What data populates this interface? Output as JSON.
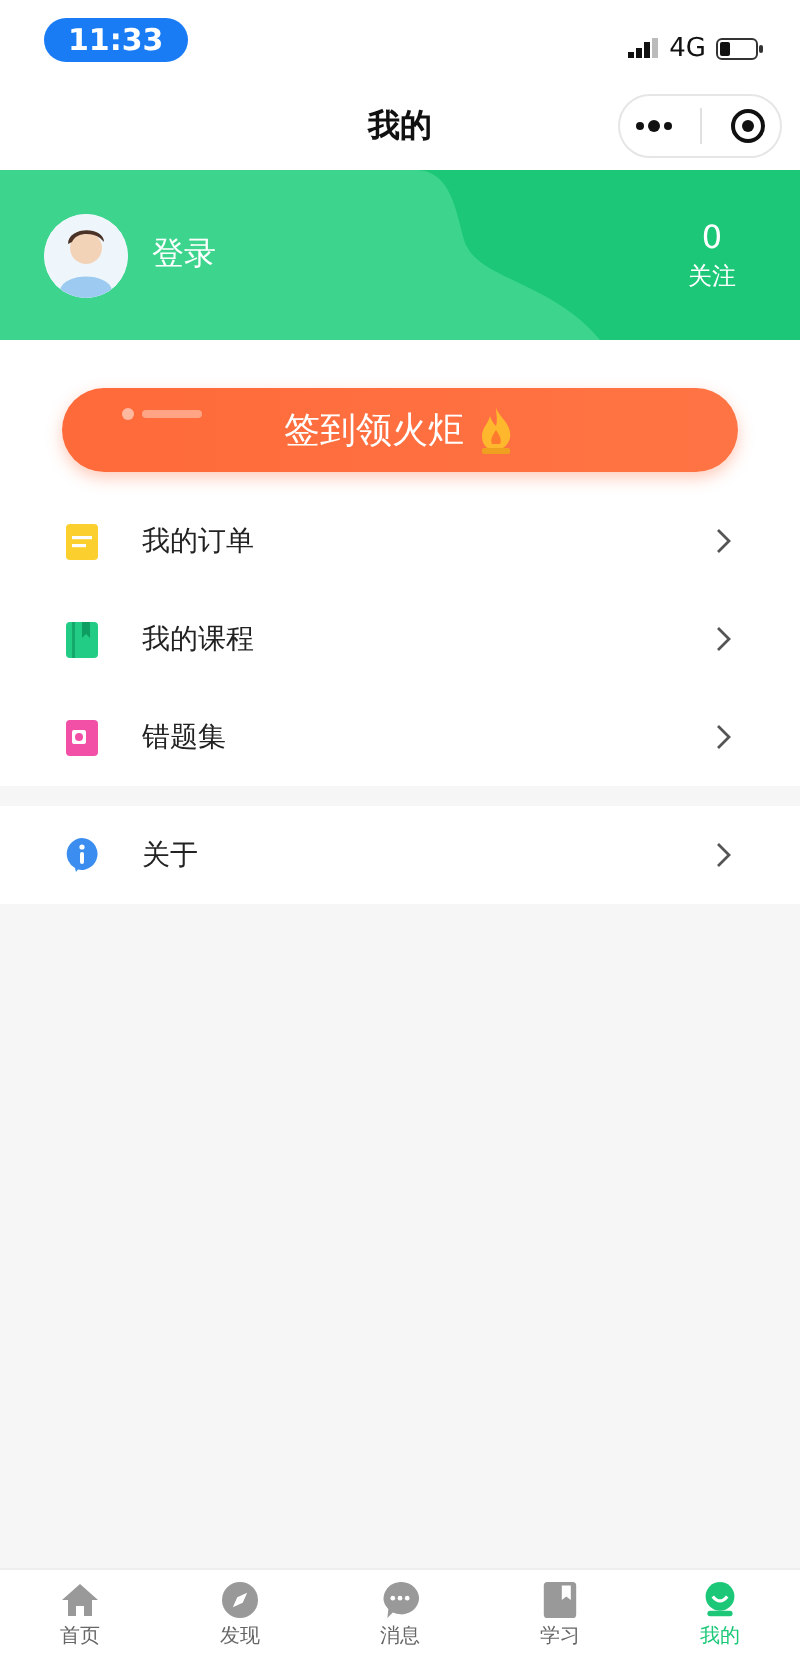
{
  "status_bar": {
    "time": "11:33",
    "network": "4G"
  },
  "nav_bar": {
    "title": "我的"
  },
  "profile": {
    "login": "登录",
    "follow_count": "0",
    "follow_label": "关注"
  },
  "checkin_button": {
    "label": "签到领火炬"
  },
  "menu_groups": [
    {
      "items": [
        {
          "kind": "order",
          "label": "我的订单"
        },
        {
          "kind": "course",
          "label": "我的课程"
        },
        {
          "kind": "mistakes",
          "label": "错题集"
        }
      ]
    },
    {
      "items": [
        {
          "kind": "about",
          "label": "关于"
        }
      ]
    }
  ],
  "tabs": [
    {
      "kind": "home",
      "label": "首页",
      "selected": false
    },
    {
      "kind": "discover",
      "label": "发现",
      "selected": false
    },
    {
      "kind": "message",
      "label": "消息",
      "selected": false
    },
    {
      "kind": "study",
      "label": "学习",
      "selected": false
    },
    {
      "kind": "me",
      "label": "我的",
      "selected": true
    }
  ]
}
